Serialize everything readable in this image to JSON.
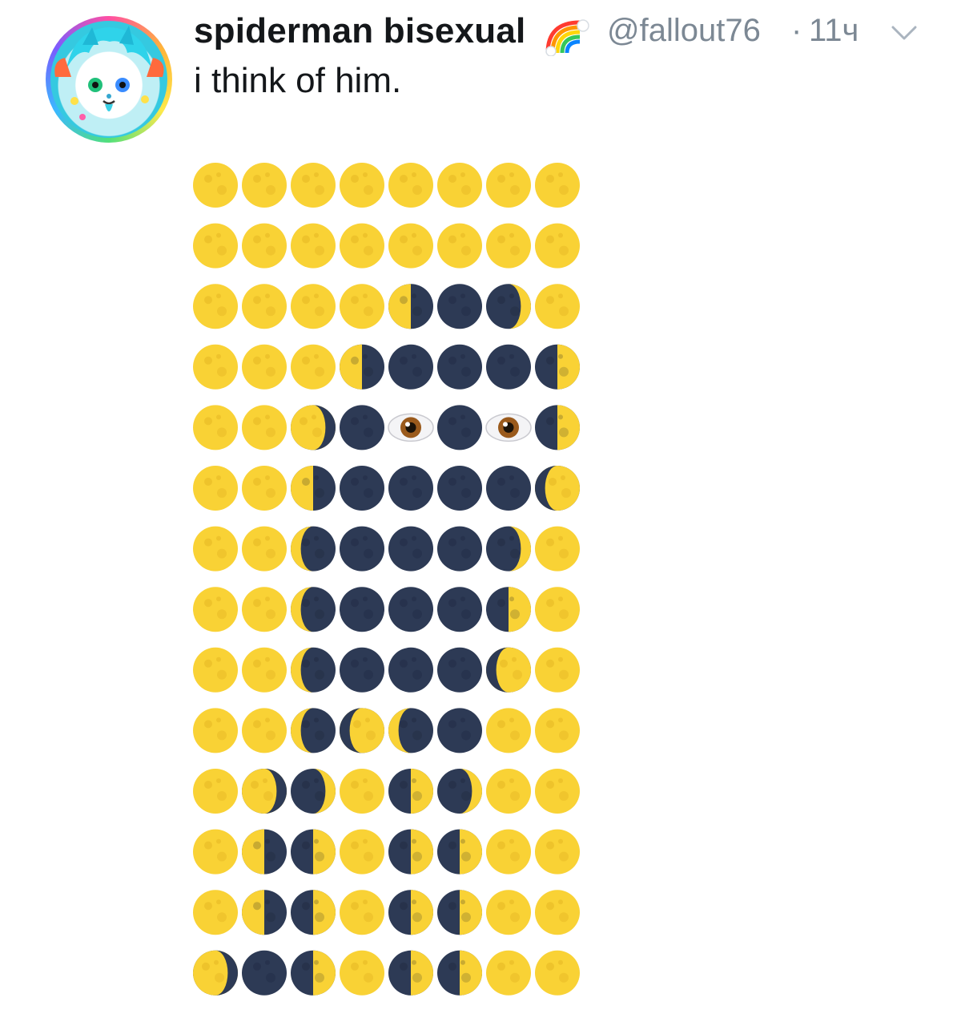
{
  "tweet": {
    "display_name": "spiderman bisexual",
    "name_badge_icon": "rainbow-icon",
    "handle": "@fallout76",
    "separator": "·",
    "age": "11ч",
    "menu_icon": "chevron-down-icon",
    "text": "i think of him.",
    "avatar_icon": "avatar-image"
  },
  "colors": {
    "text_primary": "#14171a",
    "text_secondary": "#7c8894",
    "moon_yellow": "#f9d235",
    "moon_dark": "#2d3a55",
    "background": "#ffffff"
  },
  "emoji_grid": {
    "legend": {
      "F": "full-moon",
      "N": "new-moon",
      "E": "eye",
      "W1": "waxing-crescent-moon",
      "W2": "first-quarter-moon",
      "W3": "waxing-gibbous-moon",
      "L1": "waning-gibbous-moon",
      "L2": "last-quarter-moon",
      "L3": "waning-crescent-moon"
    },
    "rows": [
      [
        "F",
        "F",
        "F",
        "F",
        "F",
        "F",
        "F",
        "F"
      ],
      [
        "F",
        "F",
        "F",
        "F",
        "F",
        "F",
        "F",
        "F"
      ],
      [
        "F",
        "F",
        "F",
        "F",
        "L2",
        "N",
        "W1",
        "F"
      ],
      [
        "F",
        "F",
        "F",
        "L2",
        "N",
        "N",
        "N",
        "W2"
      ],
      [
        "F",
        "F",
        "L1",
        "N",
        "E",
        "N",
        "E",
        "W2"
      ],
      [
        "F",
        "F",
        "L2",
        "N",
        "N",
        "N",
        "N",
        "W3"
      ],
      [
        "F",
        "F",
        "L3",
        "N",
        "N",
        "N",
        "W1",
        "F"
      ],
      [
        "F",
        "F",
        "L3",
        "N",
        "N",
        "N",
        "W2",
        "F"
      ],
      [
        "F",
        "F",
        "L3",
        "N",
        "N",
        "N",
        "W3",
        "F"
      ],
      [
        "F",
        "F",
        "L3",
        "W3",
        "L3",
        "N",
        "F",
        "F"
      ],
      [
        "F",
        "L1",
        "W1",
        "F",
        "W2",
        "W1",
        "F",
        "F"
      ],
      [
        "F",
        "L2",
        "W2",
        "F",
        "W2",
        "W2",
        "F",
        "F"
      ],
      [
        "F",
        "L2",
        "W2",
        "F",
        "W2",
        "W2",
        "F",
        "F"
      ],
      [
        "L1",
        "N",
        "W2",
        "F",
        "W2",
        "W2",
        "F",
        "F"
      ]
    ]
  }
}
